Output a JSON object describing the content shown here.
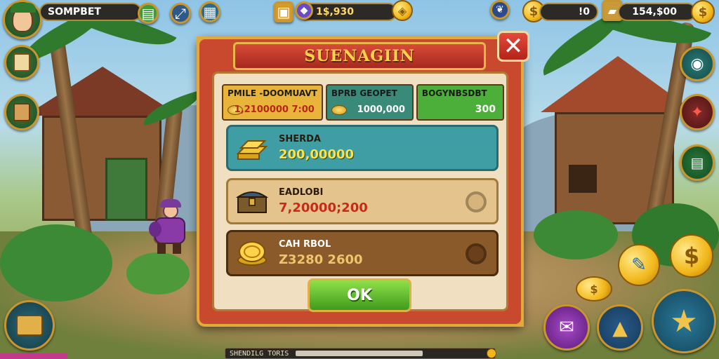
{
  "player": {
    "name": "SOMPBET"
  },
  "currencies": {
    "gems": "1$,930",
    "small_value": "!0",
    "gold": "154,$00"
  },
  "dialog": {
    "title": "SUENAGIIN",
    "close_icon": "close-x-icon",
    "tabs": [
      {
        "label": "PMILE -DOOMUAVT",
        "value": "1,2100000  7:00",
        "color": "#e8b53a"
      },
      {
        "label": "BPRB GEOPET",
        "value": "1000,000",
        "color": "#3a8a7a"
      },
      {
        "label": "BOGYNBSDBT",
        "value": "300",
        "color": "#4caf3a"
      }
    ],
    "options": [
      {
        "label": "SHERDA",
        "value": "200,00000",
        "icon": "gold-bars-icon",
        "bg": "#3f9ea3",
        "border": "#2b6a70",
        "value_color": "#ffe14a"
      },
      {
        "label": "EADLOBI",
        "value": "7,20000;200",
        "icon": "treasure-chest-icon",
        "bg": "#e4c48c",
        "border": "#a07a3a",
        "value_color": "#c82a1a"
      },
      {
        "label": "CAH RBOL",
        "value": "Z3280 2600",
        "icon": "gold-coins-icon",
        "bg": "#8a5a2a",
        "border": "#4a2c10",
        "value_color": "#f0c46a"
      }
    ],
    "ok_label": "OK"
  },
  "status_bar": {
    "label": "SHENDILG TORIS",
    "fill_pct": 68
  },
  "colors": {
    "accent": "#e2a93b",
    "dialog_red": "#c9492f",
    "ok_green": "#4caf3a"
  }
}
